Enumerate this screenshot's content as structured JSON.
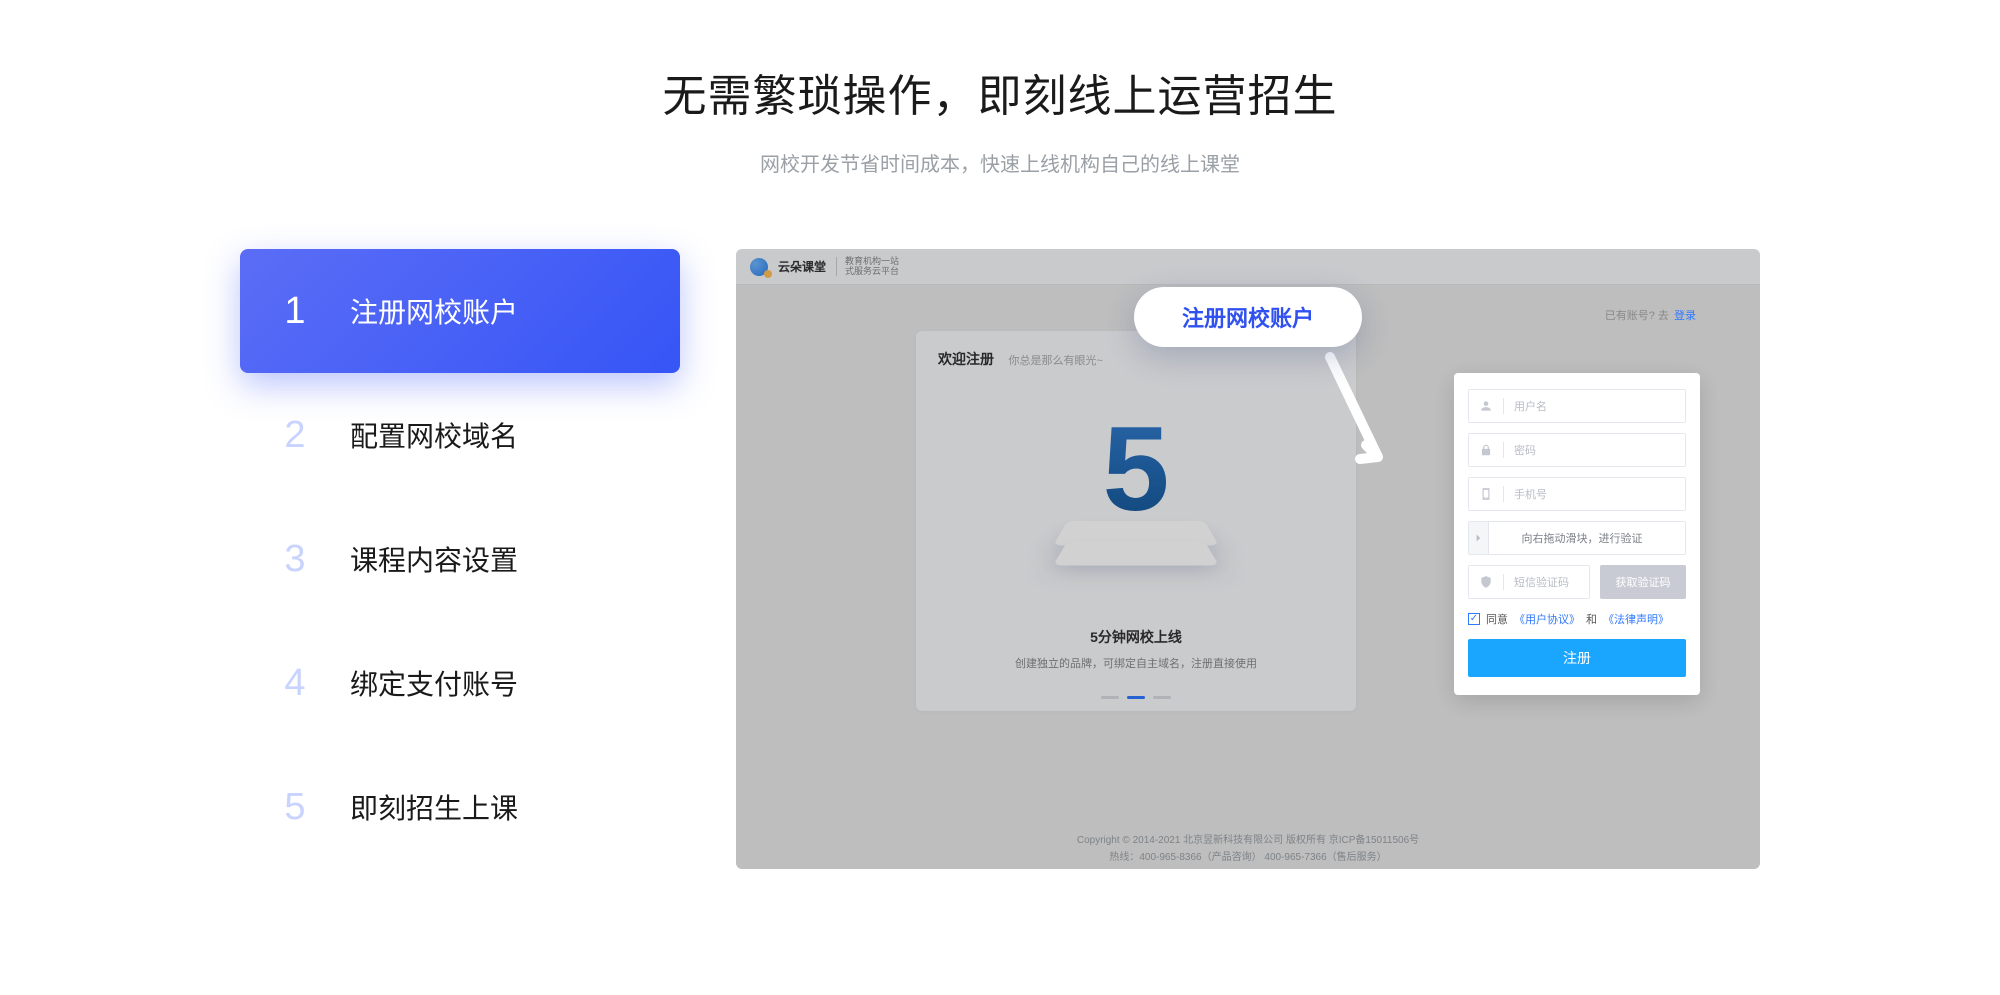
{
  "hero": {
    "title": "无需繁琐操作，即刻线上运营招生",
    "subtitle": "网校开发节省时间成本，快速上线机构自己的线上课堂"
  },
  "steps": [
    {
      "num": "1",
      "label": "注册网校账户",
      "active": true
    },
    {
      "num": "2",
      "label": "配置网校域名",
      "active": false
    },
    {
      "num": "3",
      "label": "课程内容设置",
      "active": false
    },
    {
      "num": "4",
      "label": "绑定支付账号",
      "active": false
    },
    {
      "num": "5",
      "label": "即刻招生上课",
      "active": false
    }
  ],
  "preview": {
    "logo_text": "云朵课堂",
    "logo_tagline": "教育机构一站\n式服务云平台",
    "bubble": "注册网校账户",
    "welcome_title": "欢迎注册",
    "welcome_sub": "你总是那么有眼光~",
    "big_figure": "5",
    "line1": "5分钟网校上线",
    "line2": "创建独立的品牌，可绑定自主域名，注册直接使用",
    "login_hint_prefix": "已有账号? 去",
    "login_hint_link": "登录",
    "form": {
      "username_ph": "用户名",
      "password_ph": "密码",
      "phone_ph": "手机号",
      "slider_ph": "向右拖动滑块，进行验证",
      "code_ph": "短信验证码",
      "get_code": "获取验证码",
      "agree_prefix": "同意",
      "agreement1": "《用户协议》",
      "and": "和",
      "agreement2": "《法律声明》",
      "submit": "注册"
    },
    "footer1": "Copyright © 2014-2021 北京昱新科技有限公司 版权所有   京ICP备15011506号",
    "footer2": "热线：400-965-8366（产品咨询）  400-965-7366（售后服务）"
  }
}
